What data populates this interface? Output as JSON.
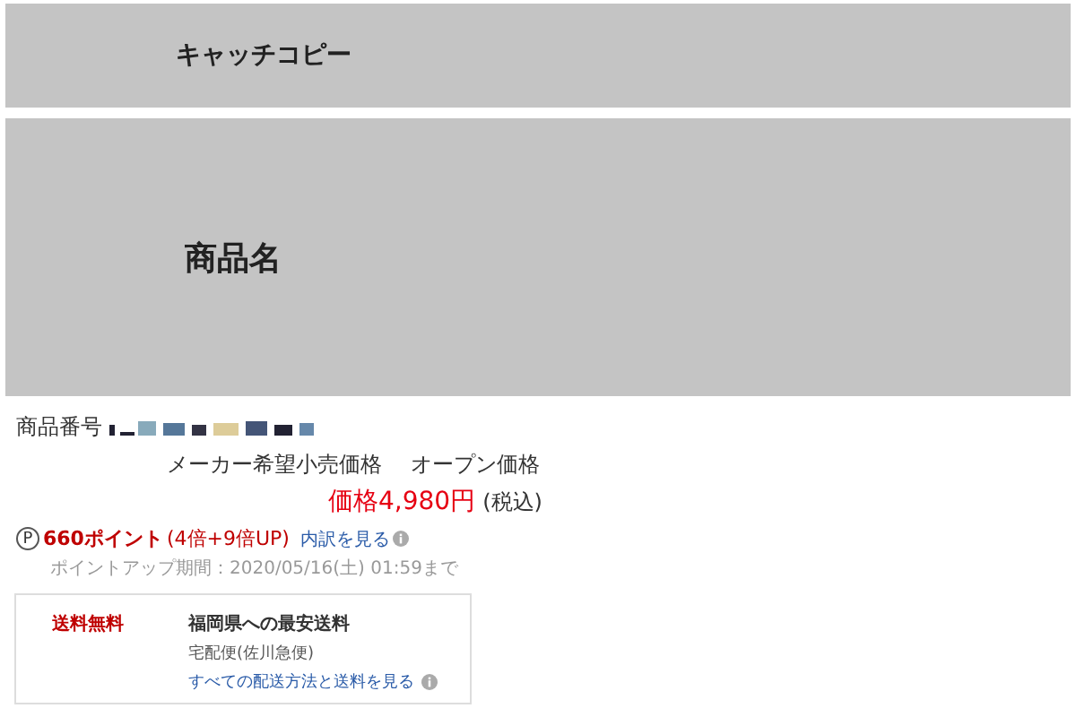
{
  "catch_copy": "キャッチコピー",
  "product_name": "商品名",
  "product_number_label": "商品番号",
  "maker_price_label": "メーカー希望小売価格",
  "maker_price_value": "オープン価格",
  "price": "価格4,980円",
  "tax_note": "(税込)",
  "points": {
    "icon": "P",
    "amount": "660ポイント",
    "multiplier": "(4倍+9倍UP)",
    "link": "内訳を見る",
    "period": "ポイントアップ期間：2020/05/16(土) 01:59まで"
  },
  "shipping": {
    "free_label": "送料無料",
    "title": "福岡県への最安送料",
    "carrier": "宅配便(佐川急便)",
    "link": "すべての配送方法と送料を見る"
  }
}
